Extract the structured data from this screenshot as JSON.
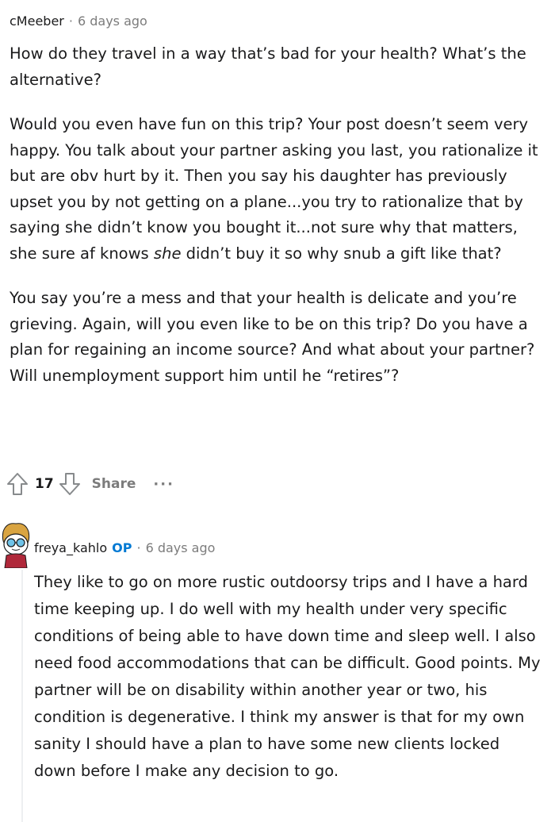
{
  "comment": {
    "username": "cMeeber",
    "separator": "·",
    "time": "6 days ago",
    "paragraphs": {
      "p1": "How do they travel in a way that’s bad for your health? What’s the alternative?",
      "p2_before": "Would you even have fun on this trip? Your post doesn’t seem very happy. You talk about your partner asking you last, you rationalize it but are obv hurt by it. Then you say his daughter has previously upset you by not getting on a plane...you try to rationalize that by saying she didn’t know you bought it...not sure why that matters, she sure af knows ",
      "p2_emph": "she",
      "p2_after": " didn’t buy it so why snub a gift like that?",
      "p3": "You say you’re a mess and that your health is delicate and you’re grieving. Again, will you even like to be on this trip? Do you have a plan for regaining an income source? And what about your partner? Will unemployment support him until he “retires”?"
    },
    "actions": {
      "upvote_icon": "upvote-arrow-icon",
      "vote_count": "17",
      "downvote_icon": "downvote-arrow-icon",
      "share_label": "Share",
      "more_label": "···"
    }
  },
  "reply": {
    "avatar_icon": "snoo-avatar-icon",
    "username": "freya_kahlo",
    "op_badge": "OP",
    "separator": "·",
    "time": "6 days ago",
    "text": "They like to go on more rustic outdoorsy trips and I have a hard time keeping up. I do well with my health under very specific conditions of being able to have down time and sleep well. I also need food accommodations that can be difficult. Good points. My partner will be on disability within another year or two, his condition is degenerative. I think my answer is that for my own sanity I should have a plan to have some new clients locked down before I make any decision to go."
  },
  "colors": {
    "text": "#1a1a1b",
    "meta": "#7c7c7c",
    "op": "#0079d3",
    "thread_line": "#edeff1"
  }
}
